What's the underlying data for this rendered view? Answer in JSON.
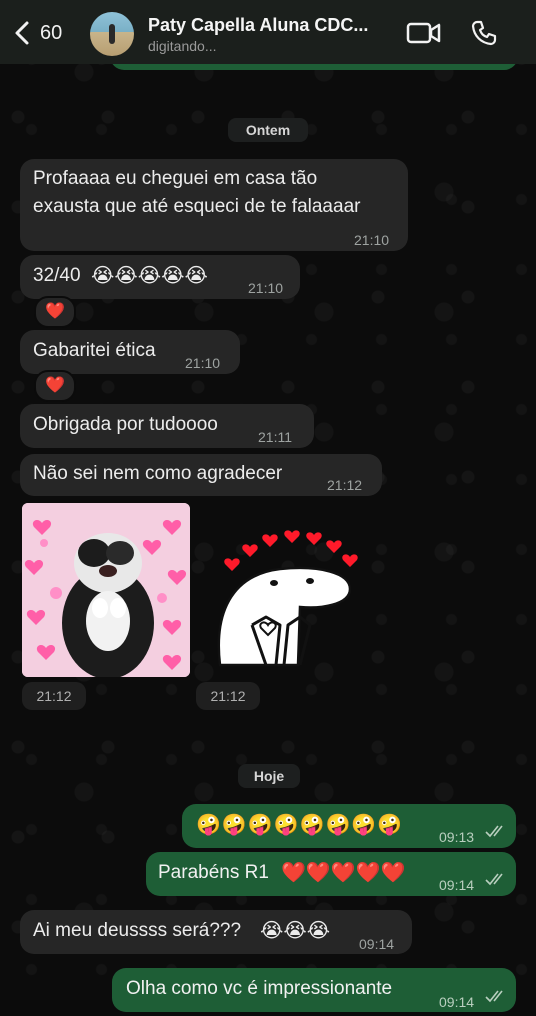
{
  "header": {
    "back_count": "60",
    "contact_name": "Paty Capella Aluna CDC...",
    "status": "digitando..."
  },
  "separators": {
    "yesterday": "Ontem",
    "today": "Hoje"
  },
  "messages": [
    {
      "text_line1": "Profaaaa eu cheguei em casa tão",
      "text_line2": "exausta que até esqueci de te falaaaar",
      "time": "21:10"
    },
    {
      "text": "32/40",
      "emojis": "😭😭😭😭😭",
      "time": "21:10",
      "reaction": "❤️"
    },
    {
      "text": "Gabaritei ética",
      "time": "21:10",
      "reaction": "❤️"
    },
    {
      "text": "Obrigada por tudoooo",
      "time": "21:11"
    },
    {
      "text": "Não sei nem como agradecer",
      "time": "21:12"
    },
    {
      "sticker1_time": "21:12",
      "sticker2_time": "21:12"
    },
    {
      "emojis": "🤪🤪🤪🤪🤪🤪🤪🤪",
      "time": "09:13"
    },
    {
      "text": "Parabéns R1",
      "emojis": "❤️❤️❤️❤️❤️",
      "time": "09:14"
    },
    {
      "text": "Ai meu deussss será???",
      "emojis": "😭😭😭",
      "time": "09:14"
    },
    {
      "text": "Olha como vc é impressionante",
      "time": "09:14"
    }
  ],
  "colors": {
    "incoming": "#262626",
    "outgoing": "#1e5e36",
    "header": "#1b1f1c"
  }
}
